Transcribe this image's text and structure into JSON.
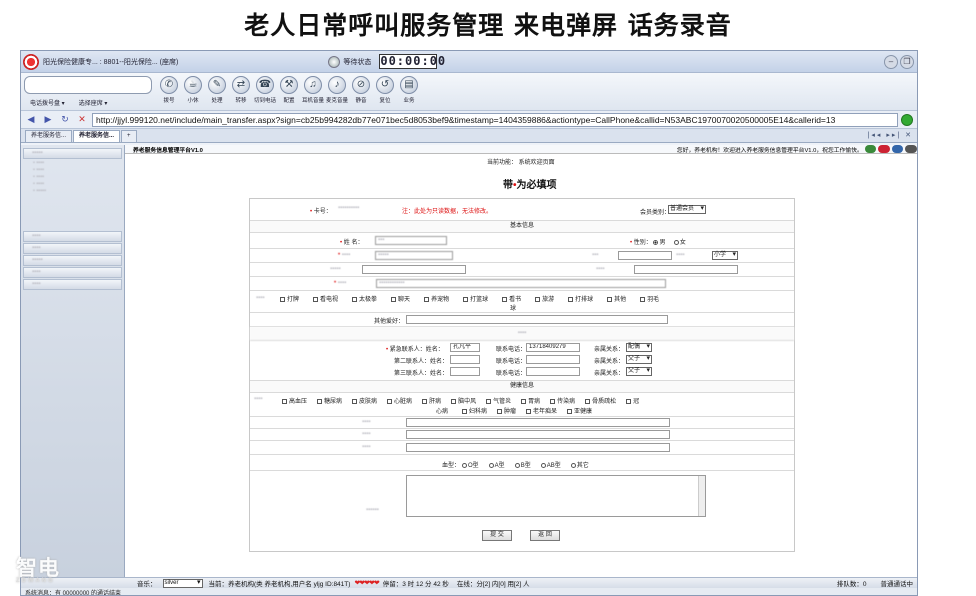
{
  "slide": {
    "title": "老人日常呼叫服务管理   来电弹屏   话务录音"
  },
  "window": {
    "title": "阳光保险健康专... : 8801--阳光保险... (座席)",
    "wait_status": "等待状态",
    "timer": "00:00:00"
  },
  "toolbar": {
    "dial_menu": "电话拨号盘 ▾",
    "queue_menu": "选择座席 ▾",
    "tools": [
      {
        "label": "拨号",
        "icon": "phone-icon",
        "glyph": "✆"
      },
      {
        "label": "小休",
        "icon": "coffee-icon",
        "glyph": "☕"
      },
      {
        "label": "处理",
        "icon": "pen-icon",
        "glyph": "✎"
      },
      {
        "label": "转移",
        "icon": "transfer-icon",
        "glyph": "⇄"
      },
      {
        "label": "切到电话",
        "icon": "handset-icon",
        "glyph": "☎"
      },
      {
        "label": "配置",
        "icon": "tools-icon",
        "glyph": "⚒"
      },
      {
        "label": "耳机音量",
        "icon": "headset-icon",
        "glyph": "♫"
      },
      {
        "label": "麦克音量",
        "icon": "mic-icon",
        "glyph": "♪"
      },
      {
        "label": "静音",
        "icon": "mute-icon",
        "glyph": "⊘"
      },
      {
        "label": "复位",
        "icon": "reset-icon",
        "glyph": "↺"
      },
      {
        "label": "业务",
        "icon": "business-icon",
        "glyph": "▤"
      }
    ]
  },
  "address": {
    "url": "http://jjyl.999120.net/include/main_transfer.aspx?sign=cb25b994282db77e071bec5d8053bef9&timestamp=1404359886&actiontype=CallPhone&callid=N53ABC1970070020500005E14&callerid=13"
  },
  "tabs": [
    {
      "label": "养老服务信..."
    },
    {
      "label": "养老服务信..."
    }
  ],
  "header": {
    "platform": "养老服务信息管理平台V1.0",
    "welcome": "您好，养老机构！欢迎进入养老服务信息管理平台V1.0，祝您工作愉快。",
    "current_function": "当前功能：  系统欢迎页面",
    "required_prefix": "带",
    "required_suffix": "为必填项"
  },
  "form": {
    "card_label": "卡号：",
    "card_note": "注：此处为只读数据，无法修改。",
    "member_type_label": "会员类别：",
    "member_type_value": "普通会员",
    "basic_section": "基本信息",
    "name_label": "姓  名：",
    "gender_label": "性别：",
    "gender_male": "男",
    "gender_female": "女",
    "edu_value": "小学",
    "hobbies": [
      "打牌",
      "看电视",
      "太极拳",
      "聊天",
      "养宠物",
      "打篮球",
      "看书",
      "旅游",
      "打排球",
      "其他",
      "羽毛"
    ],
    "hobby_wrap": "球",
    "other_hobby_label": "其他爱好：",
    "contact1_label": "紧急联系人：姓名：",
    "contact1_name": "孔凡平",
    "contact1_phone_label": "联系电话：",
    "contact1_phone": "13718409279",
    "contact1_rel_label": "亲属关系：",
    "contact1_rel": "配偶",
    "contact2_label": "第二联系人：姓名：",
    "contact2_phone_label": "联系电话：",
    "contact2_rel_label": "亲属关系：",
    "contact2_rel": "父子",
    "contact3_label": "第三联系人：姓名：",
    "contact3_phone_label": "联系电话：",
    "contact3_rel_label": "亲属关系：",
    "contact3_rel": "父子",
    "health_section": "健康信息",
    "diseases_row1": [
      "高血压",
      "糖尿病",
      "皮肤病",
      "心脏病",
      "肝病",
      "脑中风",
      "气管炎",
      "胃病",
      "传染病",
      "骨质疏松",
      "冠"
    ],
    "diseases_row2_wrap": "心病",
    "diseases_row2": [
      "妇科病",
      "肿瘤",
      "老年痴呆",
      "亚健康"
    ],
    "blood_label": "血型：",
    "blood_types": [
      "O型",
      "A型",
      "B型",
      "AB型",
      "其它"
    ],
    "submit": "提 交",
    "back": "返 回"
  },
  "status": {
    "prefix": "音乐：",
    "music_value": "silver",
    "current": "当前：养老机构(类 养老机构,用户名 yljg ID:841T)",
    "hearts": "❤❤❤❤❤",
    "stay": "停留：3 时 12 分 42 秒",
    "online": "在线：分[2] 内[0] 用[2] 人",
    "queue_label": "排队数：",
    "queue_value": "0",
    "connected": "普通通话中"
  },
  "status2": {
    "text": "系统消息：有 00000000 的通话结束"
  },
  "watermark": {
    "cn": "智电",
    "en": "ZDWANG"
  },
  "colors": {
    "accent": "#3a66b0",
    "required": "#dd1111"
  }
}
